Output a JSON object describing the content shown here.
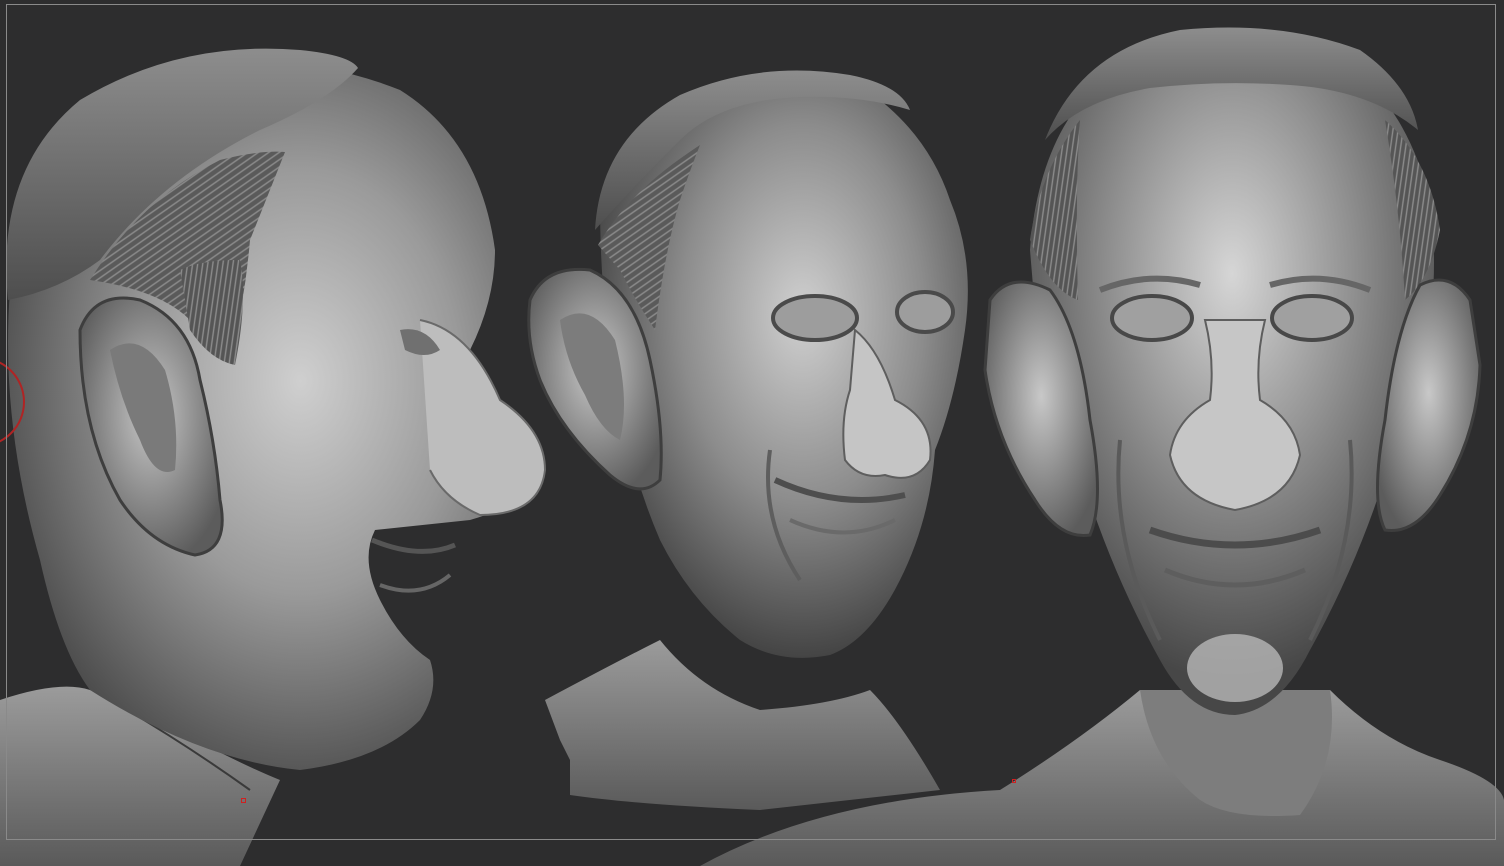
{
  "viewport": {
    "background": "#2d2d2e",
    "frame_border_color": "#8a8a8a"
  },
  "models": [
    {
      "name": "head-side-view",
      "view": "profile"
    },
    {
      "name": "head-three-quarter-view",
      "view": "three-quarter"
    },
    {
      "name": "head-front-view",
      "view": "front"
    }
  ],
  "markers": [
    {
      "name": "transpose-point-left",
      "color": "#d02020"
    },
    {
      "name": "transpose-point-right",
      "color": "#d02020"
    }
  ],
  "gizmo": {
    "name": "rotation-ring-icon",
    "color": "#b02424"
  }
}
